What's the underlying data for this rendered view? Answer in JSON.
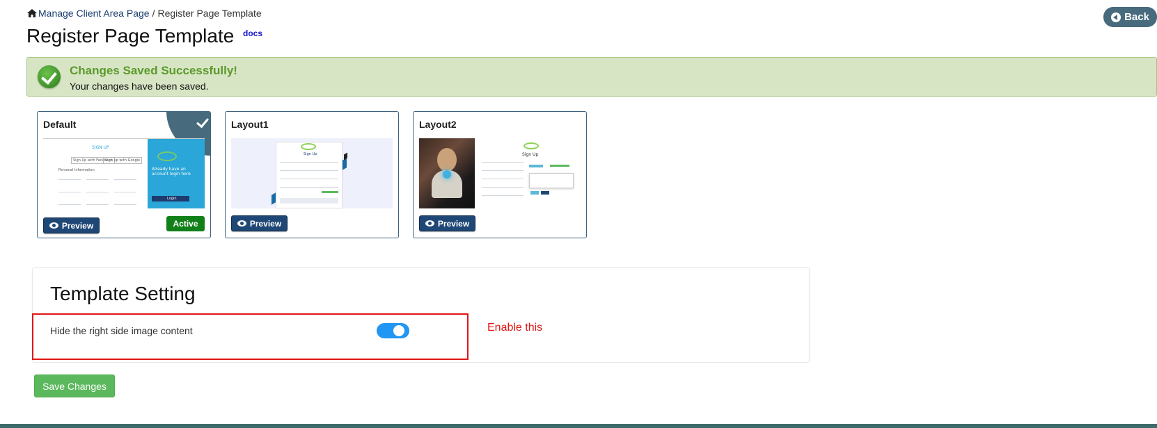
{
  "breadcrumb": {
    "parent": "Manage Client Area Page",
    "separator": "/",
    "current": "Register Page Template"
  },
  "page": {
    "title": "Register Page Template",
    "docs_label": "docs",
    "back_label": "Back"
  },
  "alert": {
    "title": "Changes Saved Successfully!",
    "message": "Your changes have been saved."
  },
  "layouts": [
    {
      "name": "Default",
      "preview_label": "Preview",
      "active_label": "Active",
      "is_active": true
    },
    {
      "name": "Layout1",
      "preview_label": "Preview",
      "is_active": false
    },
    {
      "name": "Layout2",
      "preview_label": "Preview",
      "is_active": false
    }
  ],
  "thumbnails": {
    "default": {
      "heading": "SIGN UP",
      "fb_button": "Sign Up with Facebook",
      "google_button": "Sign up with Google",
      "section": "Personal Information",
      "side_heading": "Already have an account login here",
      "side_button": "Login"
    },
    "layout1": {
      "heading": "Sign Up"
    },
    "layout2": {
      "heading": "Sign Up"
    }
  },
  "settings": {
    "title": "Template Setting",
    "hide_image_label": "Hide the right side image content",
    "hide_image_enabled": true,
    "annotation": "Enable this"
  },
  "actions": {
    "save_label": "Save Changes"
  },
  "colors": {
    "brand_dark": "#1e4775",
    "active_green": "#118018",
    "save_green": "#5cb85c",
    "toggle_blue": "#2196f3",
    "annotation_red": "#e01515"
  }
}
